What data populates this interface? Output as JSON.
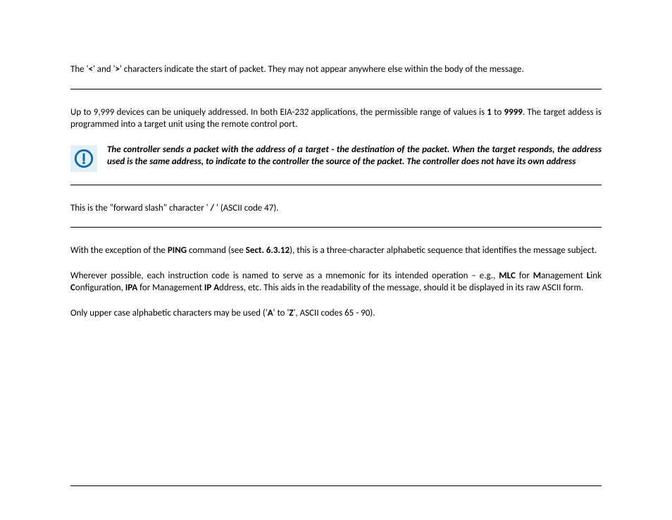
{
  "sections": {
    "s1": {
      "p1_a": "The '",
      "p1_lt": "<",
      "p1_b": "' and '",
      "p1_gt": ">",
      "p1_c": "' characters indicate the start of packet. They may not appear anywhere else within the body of the message."
    },
    "s2": {
      "p1_a": "Up to 9,999 devices can be uniquely addressed. In both EIA-232 applications, the permissible range of values is ",
      "p1_v1": "1",
      "p1_b": " to ",
      "p1_v2": "9999",
      "p1_c": ". The target addess is programmed into a target unit using the remote control port.",
      "note": "The controller sends a packet with the address of a target - the destination of the packet. When the target responds, the address used is the same address, to indicate to the controller the source of the packet. The controller does not have its own address"
    },
    "s3": {
      "p1_a": "This is the \"forward slash\" character ' ",
      "p1_slash": "/",
      "p1_b": " ' (ASCII code 47)."
    },
    "s4": {
      "p1_a": "With the exception of the ",
      "p1_ping": "PING",
      "p1_b": " command (see ",
      "p1_sect": "Sect. 6.3.12",
      "p1_c": "), this is a three-character alphabetic sequence that identifies the message subject.",
      "p2_a": "Wherever possible, each instruction code is named to serve as a mnemonic for its intended operation – e.g., ",
      "p2_mlc": "MLC",
      "p2_b": " for ",
      "p2_M": "M",
      "p2_c": "anagement ",
      "p2_L": "L",
      "p2_d": "ink ",
      "p2_C": "C",
      "p2_e": "onfiguration, ",
      "p2_ipa": "IPA",
      "p2_f": " for Management ",
      "p2_IP": "IP A",
      "p2_g": "ddress, etc. This aids in the readability of the message, should it be displayed in its raw ASCII form.",
      "p3_a": "Only upper case alphabetic characters may be used ('",
      "p3_A": "A",
      "p3_b": "' to '",
      "p3_Z": "Z",
      "p3_c": "', ASCII codes 65 - 90)."
    }
  }
}
